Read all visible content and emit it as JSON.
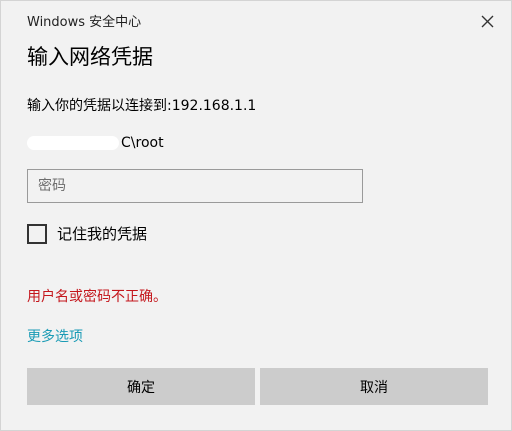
{
  "window": {
    "app_title": "Windows 安全中心",
    "close_icon": "close-icon"
  },
  "dialog": {
    "heading": "输入网络凭据",
    "instruction": "输入你的凭据以连接到:192.168.1.1",
    "username_suffix": "C\\root",
    "password_placeholder": "密码",
    "password_value": "",
    "remember_label": "记住我的凭据",
    "remember_checked": false,
    "error_message": "用户名或密码不正确。",
    "more_options": "更多选项",
    "ok_label": "确定",
    "cancel_label": "取消"
  },
  "colors": {
    "background": "#f2f2f2",
    "error": "#c4161c",
    "link": "#1a9bb5",
    "button": "#cccccc"
  }
}
